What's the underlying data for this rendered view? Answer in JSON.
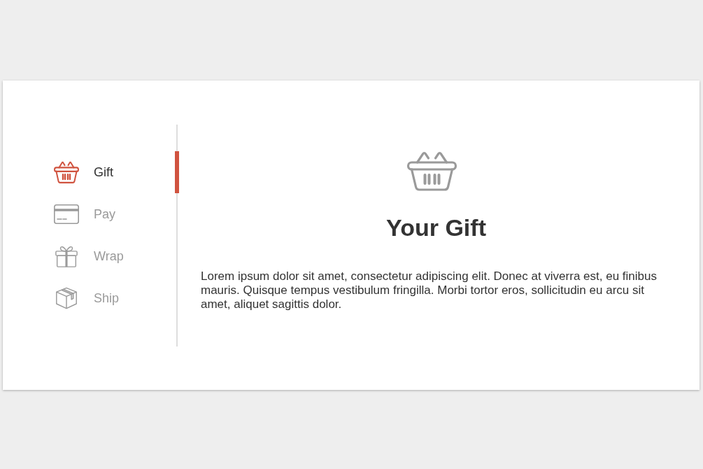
{
  "tabs": [
    {
      "label": "Gift",
      "selected": true
    },
    {
      "label": "Pay",
      "selected": false
    },
    {
      "label": "Wrap",
      "selected": false
    },
    {
      "label": "Ship",
      "selected": false
    }
  ],
  "panel": {
    "title": "Your Gift",
    "body": "Lorem ipsum dolor sit amet, consectetur adipiscing elit. Donec at viverra est, eu finibus mauris. Quisque tempus vestibulum fringilla. Morbi tortor eros, sollicitudin eu arcu sit amet, aliquet sagittis dolor."
  }
}
